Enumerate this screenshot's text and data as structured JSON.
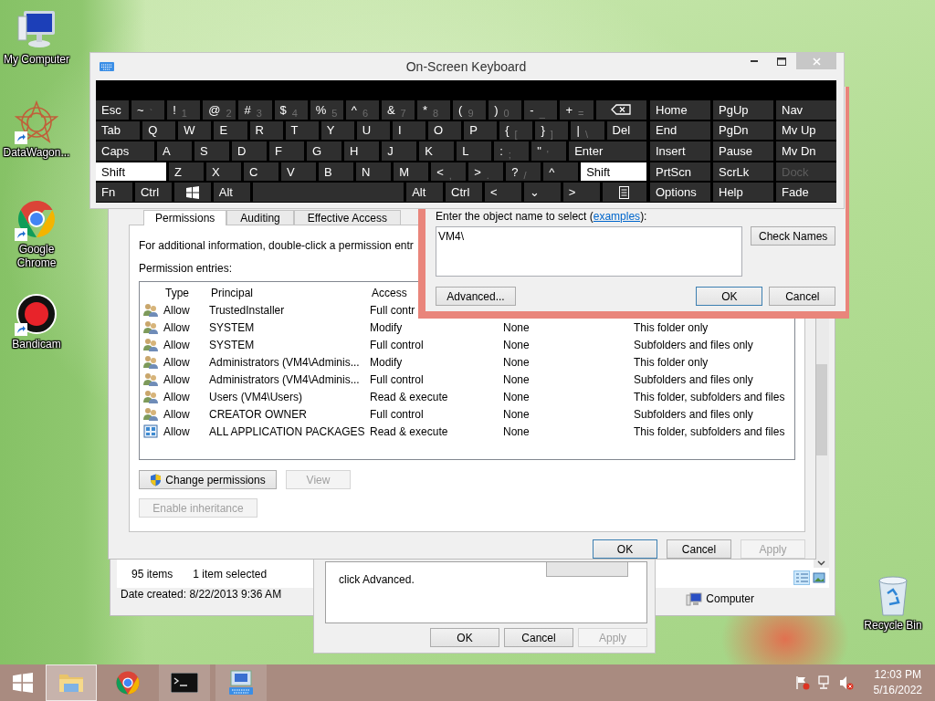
{
  "desktop_icons": [
    {
      "label": "My Computer",
      "kind": "computer",
      "shortcut": false
    },
    {
      "label": "DataWagon...",
      "kind": "star",
      "shortcut": true
    },
    {
      "label": "Google Chrome",
      "kind": "chrome",
      "shortcut": true
    },
    {
      "label": "Bandicam",
      "kind": "record",
      "shortcut": true
    }
  ],
  "recycle_bin": {
    "label": "Recycle Bin"
  },
  "explorer": {
    "status_bar": {
      "item_count": "95 items",
      "selection": "1 item selected",
      "date_created": "Date created: 8/22/2013 9:36 AM",
      "location": "Computer"
    }
  },
  "properties_dialog": {
    "text": "click Advanced.",
    "buttons": [
      {
        "label": "OK",
        "disabled": false,
        "default": false
      },
      {
        "label": "Cancel",
        "disabled": false,
        "default": false
      },
      {
        "label": "Apply",
        "disabled": true,
        "default": false
      }
    ]
  },
  "advanced_security": {
    "tabs": [
      {
        "label": "Permissions",
        "selected": true
      },
      {
        "label": "Auditing",
        "selected": false
      },
      {
        "label": "Effective Access",
        "selected": false
      }
    ],
    "info": "For additional information, double-click a permission entr",
    "entries_label": "Permission entries:",
    "table": {
      "columns": [
        "Type",
        "Principal",
        "Access"
      ],
      "rows": [
        {
          "kind": "group",
          "cells": [
            "Allow",
            "TrustedInstaller",
            "Full contr"
          ]
        },
        {
          "kind": "group",
          "cells": [
            "Allow",
            "SYSTEM",
            "Modify",
            "None",
            "This folder only"
          ]
        },
        {
          "kind": "group",
          "cells": [
            "Allow",
            "SYSTEM",
            "Full control",
            "None",
            "Subfolders and files only"
          ]
        },
        {
          "kind": "group",
          "cells": [
            "Allow",
            "Administrators (VM4\\Adminis...",
            "Modify",
            "None",
            "This folder only"
          ]
        },
        {
          "kind": "group",
          "cells": [
            "Allow",
            "Administrators (VM4\\Adminis...",
            "Full control",
            "None",
            "Subfolders and files only"
          ]
        },
        {
          "kind": "group",
          "cells": [
            "Allow",
            "Users (VM4\\Users)",
            "Read & execute",
            "None",
            "This folder, subfolders and files"
          ]
        },
        {
          "kind": "group",
          "cells": [
            "Allow",
            "CREATOR OWNER",
            "Full control",
            "None",
            "Subfolders and files only"
          ]
        },
        {
          "kind": "package",
          "cells": [
            "Allow",
            "ALL APPLICATION PACKAGES",
            "Read & execute",
            "None",
            "This folder, subfolders and files"
          ]
        }
      ]
    },
    "actions": [
      {
        "label": "Change permissions",
        "disabled": false,
        "shield": true
      },
      {
        "label": "View",
        "disabled": true,
        "shield": false
      }
    ],
    "inheritance_button": {
      "label": "Enable inheritance",
      "disabled": true
    },
    "buttons": [
      {
        "label": "OK",
        "disabled": false,
        "default": true
      },
      {
        "label": "Cancel",
        "disabled": false,
        "default": false
      },
      {
        "label": "Apply",
        "disabled": true,
        "default": false
      }
    ]
  },
  "select_dialog": {
    "prompt_before": "Enter the object name to select (",
    "link": "examples",
    "prompt_after": "):",
    "value": "VM4\\",
    "check_names": "Check Names",
    "advanced": "Advanced...",
    "buttons": [
      {
        "label": "OK",
        "disabled": false,
        "default": true
      },
      {
        "label": "Cancel",
        "disabled": false,
        "default": false
      }
    ]
  },
  "keyboard": {
    "title": "On-Screen Keyboard",
    "rows": [
      {
        "keys": [
          {
            "label": "Esc",
            "kind": "esc",
            "pressed": false
          },
          {
            "label": "~",
            "sub": "`",
            "kind": "key",
            "pressed": false
          },
          {
            "label": "!",
            "sub": "1",
            "kind": "key",
            "pressed": false
          },
          {
            "label": "@",
            "sub": "2",
            "kind": "key",
            "pressed": false
          },
          {
            "label": "#",
            "sub": "3",
            "kind": "key",
            "pressed": false
          },
          {
            "label": "$",
            "sub": "4",
            "kind": "key",
            "pressed": false
          },
          {
            "label": "%",
            "sub": "5",
            "kind": "key",
            "pressed": false
          },
          {
            "label": "^",
            "sub": "6",
            "kind": "key",
            "pressed": false
          },
          {
            "label": "&",
            "sub": "7",
            "kind": "key",
            "pressed": false
          },
          {
            "label": "*",
            "sub": "8",
            "kind": "key",
            "pressed": false
          },
          {
            "label": "(",
            "sub": "9",
            "kind": "key",
            "pressed": false
          },
          {
            "label": ")",
            "sub": "0",
            "kind": "key",
            "pressed": false
          },
          {
            "label": "-",
            "sub": "_",
            "kind": "key",
            "pressed": false
          },
          {
            "label": "+",
            "sub": "=",
            "kind": "key",
            "pressed": false
          },
          {
            "kind": "backspace",
            "pressed": false
          }
        ]
      },
      {
        "keys": [
          {
            "label": "Tab",
            "kind": "tab",
            "pressed": false
          },
          {
            "label": "Q",
            "kind": "key",
            "pressed": false
          },
          {
            "label": "W",
            "kind": "key",
            "pressed": false
          },
          {
            "label": "E",
            "kind": "key",
            "pressed": false
          },
          {
            "label": "R",
            "kind": "key",
            "pressed": false
          },
          {
            "label": "T",
            "kind": "key",
            "pressed": false
          },
          {
            "label": "Y",
            "kind": "key",
            "pressed": false
          },
          {
            "label": "U",
            "kind": "key",
            "pressed": false
          },
          {
            "label": "I",
            "kind": "key",
            "pressed": false
          },
          {
            "label": "O",
            "kind": "key",
            "pressed": false
          },
          {
            "label": "P",
            "kind": "key",
            "pressed": false
          },
          {
            "label": "{",
            "sub": "[",
            "kind": "key",
            "pressed": false
          },
          {
            "label": "}",
            "sub": "]",
            "kind": "key",
            "pressed": false
          },
          {
            "label": "|",
            "sub": "\\",
            "kind": "key",
            "pressed": false
          },
          {
            "label": "Del",
            "kind": "del",
            "pressed": false
          }
        ]
      },
      {
        "keys": [
          {
            "label": "Caps",
            "kind": "caps",
            "pressed": false
          },
          {
            "label": "A",
            "kind": "key",
            "pressed": false
          },
          {
            "label": "S",
            "kind": "key",
            "pressed": false
          },
          {
            "label": "D",
            "kind": "key",
            "pressed": false
          },
          {
            "label": "F",
            "kind": "key",
            "pressed": false
          },
          {
            "label": "G",
            "kind": "key",
            "pressed": false
          },
          {
            "label": "H",
            "kind": "key",
            "pressed": false
          },
          {
            "label": "J",
            "kind": "key",
            "pressed": false
          },
          {
            "label": "K",
            "kind": "key",
            "pressed": false
          },
          {
            "label": "L",
            "kind": "key",
            "pressed": false
          },
          {
            "label": ":",
            "sub": ";",
            "kind": "key",
            "pressed": false
          },
          {
            "label": "\"",
            "sub": "'",
            "kind": "key",
            "pressed": false
          },
          {
            "label": "Enter",
            "kind": "enter",
            "pressed": false
          }
        ]
      },
      {
        "keys": [
          {
            "label": "Shift",
            "kind": "lshift",
            "pressed": true
          },
          {
            "label": "Z",
            "kind": "key",
            "pressed": false
          },
          {
            "label": "X",
            "kind": "key",
            "pressed": false
          },
          {
            "label": "C",
            "kind": "key",
            "pressed": false
          },
          {
            "label": "V",
            "kind": "key",
            "pressed": false
          },
          {
            "label": "B",
            "kind": "key",
            "pressed": false
          },
          {
            "label": "N",
            "kind": "key",
            "pressed": false
          },
          {
            "label": "M",
            "kind": "key",
            "pressed": false
          },
          {
            "label": "<",
            "sub": ",",
            "kind": "key",
            "pressed": false
          },
          {
            "label": ">",
            "sub": ".",
            "kind": "key",
            "pressed": false
          },
          {
            "label": "?",
            "sub": "/",
            "kind": "key",
            "pressed": false
          },
          {
            "label": "^",
            "kind": "key",
            "pressed": false
          },
          {
            "label": "Shift",
            "kind": "rshift",
            "pressed": true
          }
        ]
      },
      {
        "keys": [
          {
            "label": "Fn",
            "kind": "key",
            "pressed": false
          },
          {
            "label": "Ctrl",
            "kind": "key",
            "pressed": false
          },
          {
            "kind": "windows",
            "pressed": false
          },
          {
            "label": "Alt",
            "kind": "key",
            "pressed": false
          },
          {
            "kind": "space",
            "pressed": false
          },
          {
            "label": "Alt",
            "kind": "key",
            "pressed": false
          },
          {
            "label": "Ctrl",
            "kind": "key",
            "pressed": false
          },
          {
            "label": "<",
            "kind": "key",
            "pressed": false
          },
          {
            "label": "⌄",
            "kind": "key",
            "pressed": false
          },
          {
            "label": ">",
            "kind": "key",
            "pressed": false
          },
          {
            "kind": "menu",
            "pressed": false
          }
        ]
      }
    ],
    "nav_keys": [
      {
        "label": "Home",
        "disabled": false
      },
      {
        "label": "PgUp",
        "disabled": false
      },
      {
        "label": "Nav",
        "disabled": false
      },
      {
        "label": "End",
        "disabled": false
      },
      {
        "label": "PgDn",
        "disabled": false
      },
      {
        "label": "Mv Up",
        "disabled": false
      },
      {
        "label": "Insert",
        "disabled": false
      },
      {
        "label": "Pause",
        "disabled": false
      },
      {
        "label": "Mv Dn",
        "disabled": false
      },
      {
        "label": "PrtScn",
        "disabled": false
      },
      {
        "label": "ScrLk",
        "disabled": false
      },
      {
        "label": "Dock",
        "disabled": true
      },
      {
        "label": "Options",
        "disabled": false
      },
      {
        "label": "Help",
        "disabled": false
      },
      {
        "label": "Fade",
        "disabled": false
      }
    ]
  },
  "taskbar": {
    "items": [
      {
        "kind": "explorer",
        "running": true,
        "selected": true
      },
      {
        "kind": "chrome",
        "running": false,
        "selected": false
      },
      {
        "kind": "terminal",
        "running": true,
        "selected": false
      },
      {
        "kind": "keyboard",
        "running": true,
        "selected": false
      }
    ],
    "clock": {
      "time": "12:03 PM",
      "date": "5/16/2022"
    }
  }
}
